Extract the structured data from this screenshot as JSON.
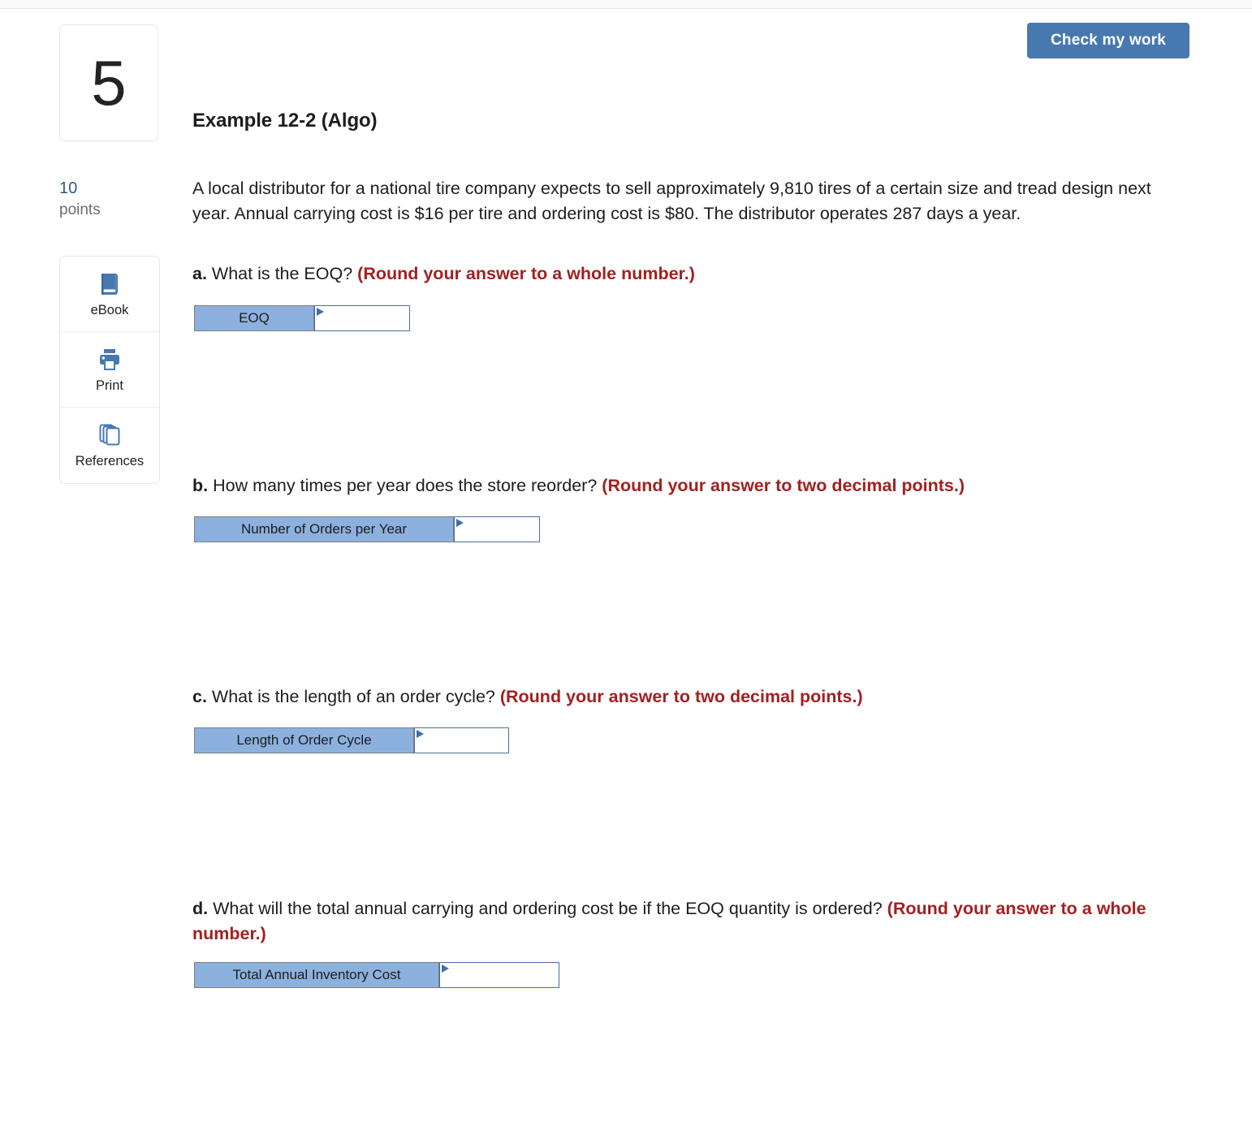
{
  "toolbar": {
    "check_my_work": "Check my work"
  },
  "question_meta": {
    "number": "5",
    "points_value": "10",
    "points_label": "points"
  },
  "tools": [
    {
      "label": "eBook",
      "icon": "book-icon"
    },
    {
      "label": "Print",
      "icon": "printer-icon"
    },
    {
      "label": "References",
      "icon": "copy-pages-icon"
    }
  ],
  "main": {
    "title": "Example 12-2 (Algo)",
    "prompt": "A local distributor for a national tire company expects to sell approximately 9,810 tires of a certain size and tread design next year. Annual carrying cost is $16 per tire and ordering cost is $80. The distributor operates 287 days a year.",
    "questions": [
      {
        "letter": "a.",
        "text": " What is the EOQ? ",
        "hint": "(Round your answer to a whole number.)",
        "answer_label": "EOQ",
        "answer_value": "",
        "label_width": 148,
        "input_width": 118
      },
      {
        "letter": "b.",
        "text": " How many times per year does the store reorder? ",
        "hint": "(Round your answer to two decimal points.)",
        "answer_label": "Number of Orders per Year",
        "answer_value": "",
        "label_width": 320,
        "input_width": 106
      },
      {
        "letter": "c.",
        "text": " What is the length of an order cycle? ",
        "hint": "(Round your answer to two decimal points.)",
        "answer_label": "Length of Order Cycle",
        "answer_value": "",
        "label_width": 271,
        "input_width": 117
      },
      {
        "letter": "d.",
        "text": " What will the total annual carrying and ordering cost be if the EOQ quantity is ordered? ",
        "hint": "(Round your answer to a whole number.)",
        "answer_label": "Total Annual Inventory Cost",
        "answer_value": "",
        "label_width": 302,
        "input_width": 148
      }
    ]
  },
  "colors": {
    "accent_blue": "#4878b0",
    "label_blue": "#8cb1de",
    "hint_red": "#a32020",
    "points_blue": "#2d5a8e"
  }
}
